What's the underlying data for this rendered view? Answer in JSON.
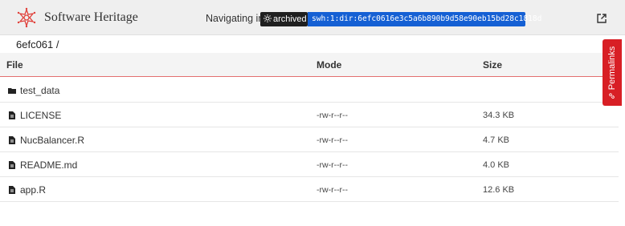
{
  "header": {
    "brand": "Software Heritage",
    "navigating_label": "Navigating in",
    "archived_label": "archived",
    "swhid": "swh:1:dir:6efc0616e3c5a6b890b9d58e90eb15bd28c1818d"
  },
  "breadcrumb": "6efc061 /",
  "permalinks_label": "Permalinks",
  "table": {
    "columns": [
      "File",
      "Mode",
      "Size"
    ],
    "rows": [
      {
        "name": "test_data",
        "type": "folder",
        "mode": "",
        "size": ""
      },
      {
        "name": "LICENSE",
        "type": "file",
        "mode": "-rw-r--r--",
        "size": "34.3 KB"
      },
      {
        "name": "NucBalancer.R",
        "type": "file",
        "mode": "-rw-r--r--",
        "size": "4.7 KB"
      },
      {
        "name": "README.md",
        "type": "file",
        "mode": "-rw-r--r--",
        "size": "4.0 KB"
      },
      {
        "name": "app.R",
        "type": "file",
        "mode": "-rw-r--r--",
        "size": "12.6 KB"
      }
    ]
  },
  "colors": {
    "brand_red": "#d81f25",
    "swhid_blue": "#1560d4",
    "header_bg": "#efefef"
  },
  "icons": {
    "logo": "software-heritage-logo-icon",
    "folder": "folder-icon",
    "file": "file-icon",
    "external": "external-link-icon",
    "link": "link-icon",
    "sun": "sun-icon"
  }
}
